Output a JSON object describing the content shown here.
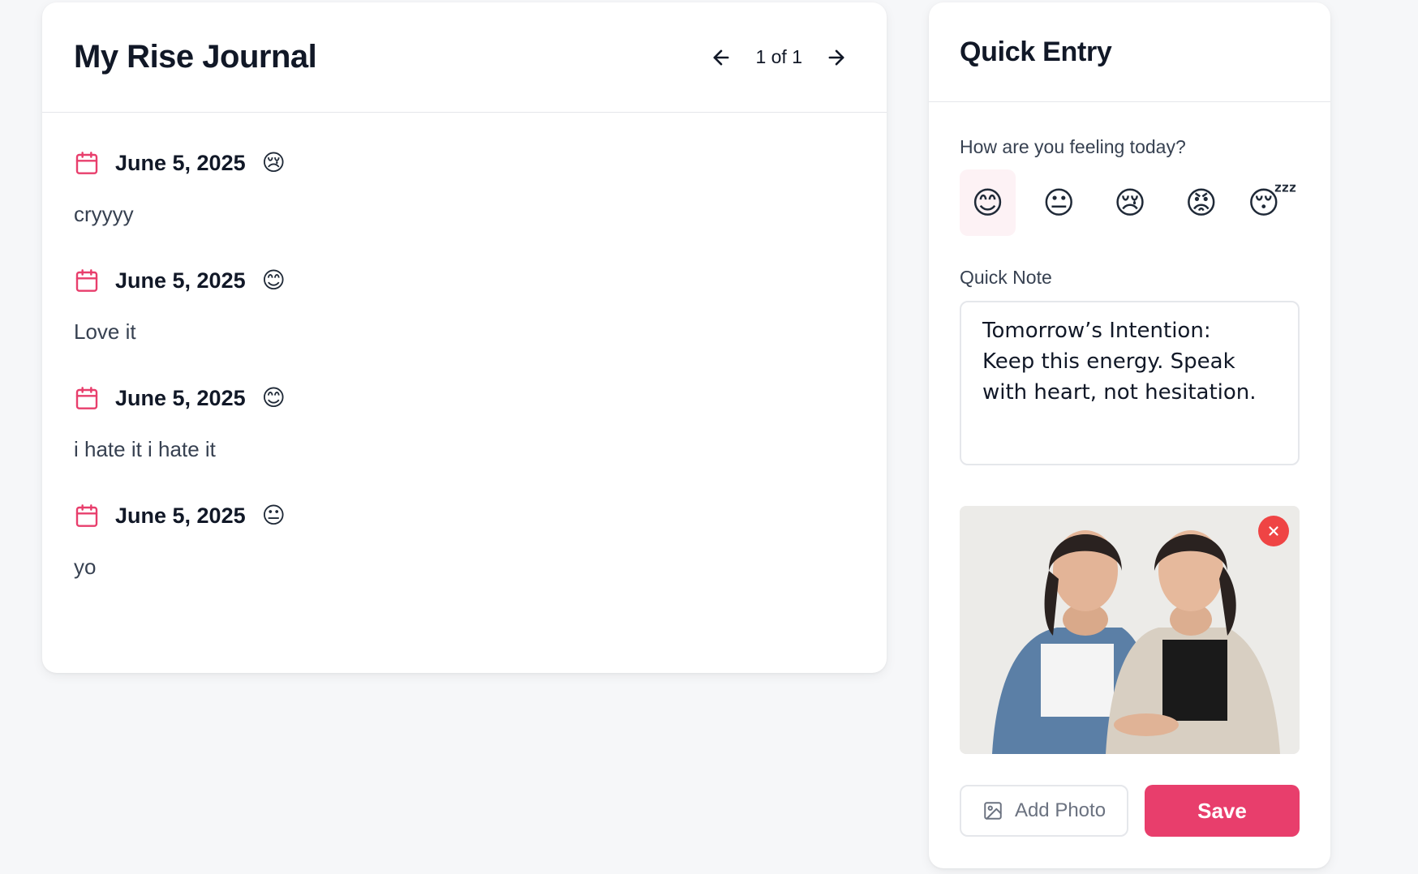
{
  "journal": {
    "title": "My Rise Journal",
    "pager": "1 of 1",
    "entries": [
      {
        "date": "June 5, 2025",
        "mood": "😢",
        "text": "cryyyy"
      },
      {
        "date": "June 5, 2025",
        "mood": "😊",
        "text": "Love it"
      },
      {
        "date": "June 5, 2025",
        "mood": "😊",
        "text": "i hate it i hate it"
      },
      {
        "date": "June 5, 2025",
        "mood": "😐",
        "text": "yo"
      }
    ]
  },
  "quick_entry": {
    "title": "Quick Entry",
    "feeling_label": "How are you feeling today?",
    "moods": [
      "😊",
      "😐",
      "😢",
      "😡",
      "😴"
    ],
    "selected_mood": 0,
    "note_label": "Quick Note",
    "note_value": "Tomorrow’s Intention:\nKeep this energy. Speak with heart, not hesitation.",
    "add_photo_label": "Add Photo",
    "save_label": "Save"
  },
  "colors": {
    "accent": "#e83e6c",
    "remove": "#ef4444",
    "selected_mood_bg": "#fdf2f5"
  },
  "icons": {
    "prev": "arrow-left-icon",
    "next": "arrow-right-icon",
    "entry_date": "calendar-icon",
    "remove_photo": "close-icon",
    "add_photo": "image-icon"
  }
}
